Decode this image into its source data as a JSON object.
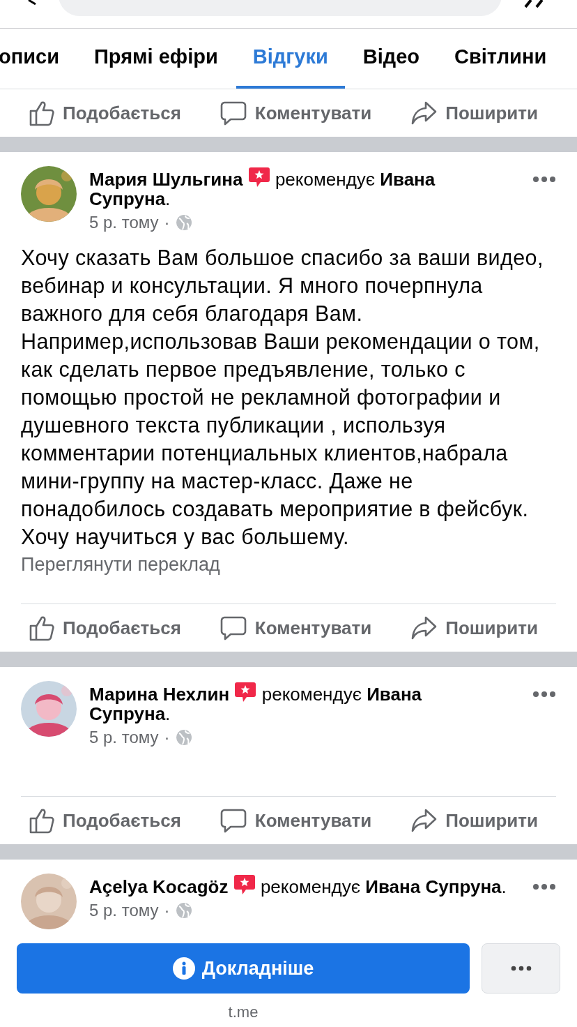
{
  "tabs": [
    {
      "label": "описи",
      "selected": false
    },
    {
      "label": "Прямі ефіри",
      "selected": false
    },
    {
      "label": "Відгуки",
      "selected": true
    },
    {
      "label": "Відео",
      "selected": false
    },
    {
      "label": "Світлини",
      "selected": false
    }
  ],
  "posts": [
    {
      "actions": [
        {
          "kind": "like",
          "label": "Подобається"
        },
        {
          "kind": "comment",
          "label": "Коментувати"
        },
        {
          "kind": "share",
          "label": "Поширити"
        }
      ]
    },
    {
      "author": "Мария Шульгина",
      "recommendation_lines": [
        "рекомендує **Ивана**",
        "**Супруна**."
      ],
      "time": "5 р. тому",
      "time_separator": "·",
      "text": "Хочу сказать Вам большое спасибо за ваши видео, вебинар и консультации. Я много почерпнула важного для себя благодаря Вам.\nНапример,использовав Ваши рекомендации о том, как сделать первое предъявление, только с помощью простой не рекламной фотографии и душевного текста публикации , используя комментарии потенциальных клиентов,набрала мини-группу на мастер-класс. Даже не понадобилось создавать мероприятие в фейсбук. Хочу научиться у вас большему.",
      "translation_link": "Переглянути переклад",
      "actions": [
        {
          "kind": "like",
          "label": "Подобається"
        },
        {
          "kind": "comment",
          "label": "Коментувати"
        },
        {
          "kind": "share",
          "label": "Поширити"
        }
      ]
    },
    {
      "author": "Марина Нехлин",
      "recommendation_lines": [
        "рекомендує **Ивана**",
        "**Супруна**."
      ],
      "time": "5 р. тому",
      "time_separator": "·",
      "actions": [
        {
          "kind": "like",
          "label": "Подобається"
        },
        {
          "kind": "comment",
          "label": "Коментувати"
        },
        {
          "kind": "share",
          "label": "Поширити"
        }
      ]
    },
    {
      "author": "Açelya Kocagöz",
      "recommendation_lines": [
        "рекомендує **Ивана Супруна**."
      ],
      "time": "5 р. тому",
      "time_separator": "·"
    }
  ],
  "footer": {
    "primary_button": "Докладніше",
    "domain": "t.me"
  }
}
